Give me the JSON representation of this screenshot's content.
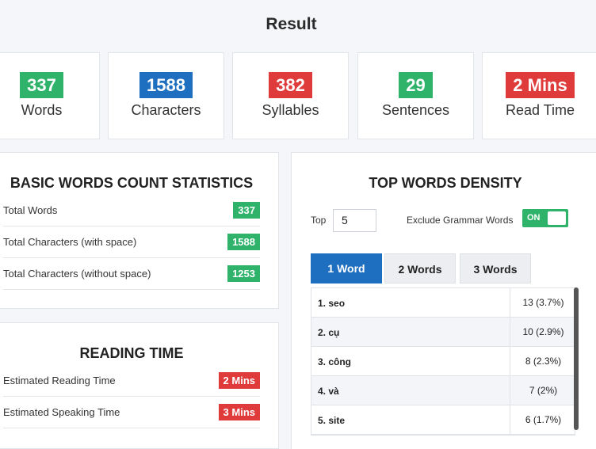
{
  "header": {
    "title": "Result"
  },
  "stats": [
    {
      "value": "337",
      "label": "Words",
      "color": "#2fb36a"
    },
    {
      "value": "1588",
      "label": "Characters",
      "color": "#1f6fc0"
    },
    {
      "value": "382",
      "label": "Syllables",
      "color": "#e03b3b"
    },
    {
      "value": "29",
      "label": "Sentences",
      "color": "#2fb36a"
    },
    {
      "value": "2 Mins",
      "label": "Read Time",
      "color": "#e03b3b"
    }
  ],
  "basic": {
    "title": "BASIC WORDS COUNT STATISTICS",
    "rows": [
      {
        "label": "Total Words",
        "value": "337"
      },
      {
        "label": "Total Characters (with space)",
        "value": "1588"
      },
      {
        "label": "Total Characters (without space)",
        "value": "1253"
      }
    ]
  },
  "reading": {
    "title": "READING TIME",
    "rows": [
      {
        "label": "Estimated Reading Time",
        "value": "2 Mins"
      },
      {
        "label": "Estimated Speaking Time",
        "value": "3 Mins"
      }
    ]
  },
  "density": {
    "title": "TOP WORDS DENSITY",
    "top_label": "Top",
    "top_value": "5",
    "exclude_label": "Exclude Grammar Words",
    "toggle_text": "ON",
    "tabs": [
      "1 Word",
      "2 Words",
      "3 Words"
    ],
    "rows": [
      {
        "word": "1. seo",
        "value": "13 (3.7%)"
      },
      {
        "word": "2. cụ",
        "value": "10 (2.9%)"
      },
      {
        "word": "3. công",
        "value": "8 (2.3%)"
      },
      {
        "word": "4. và",
        "value": "7 (2%)"
      },
      {
        "word": "5. site",
        "value": "6 (1.7%)"
      }
    ]
  }
}
